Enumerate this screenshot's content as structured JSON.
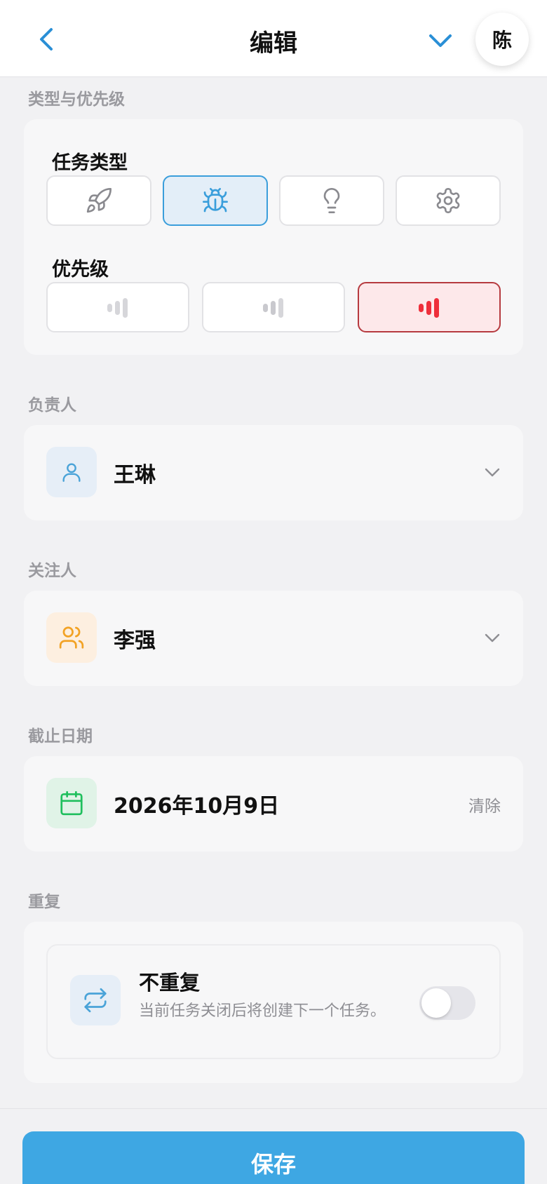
{
  "header": {
    "title": "编辑",
    "avatar_text": "陈"
  },
  "sections": {
    "type_priority": "类型与优先级",
    "assignee": "负责人",
    "watcher": "关注人",
    "due_date": "截止日期",
    "repeat": "重复"
  },
  "task_type": {
    "label": "任务类型",
    "options": [
      "rocket-icon",
      "bug-icon",
      "lightbulb-icon",
      "gear-icon"
    ],
    "selected_index": 1
  },
  "priority": {
    "label": "优先级",
    "selected_index": 2
  },
  "assignee": {
    "name": "王琳"
  },
  "watcher": {
    "name": "李强"
  },
  "due_date": {
    "value": "2026年10月9日",
    "clear_label": "清除"
  },
  "repeat": {
    "title": "不重复",
    "description": "当前任务关闭后将创建下一个任务。",
    "enabled": false
  },
  "footer": {
    "save_label": "保存"
  },
  "colors": {
    "accent": "#3ea7e3",
    "selected_blue": "#3a9edb",
    "priority_high": "#ee2f3b",
    "assignee_icon": "#4aa3d8",
    "watcher_icon": "#f2a224",
    "calendar_icon": "#1fbf5d"
  }
}
